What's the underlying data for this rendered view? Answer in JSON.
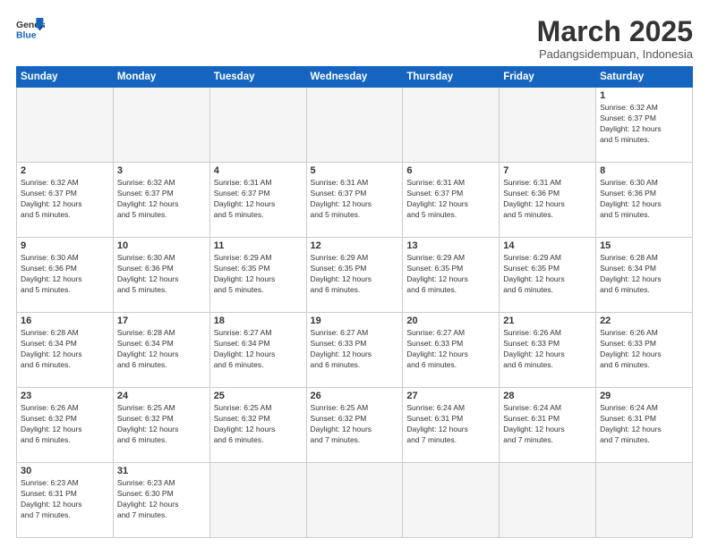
{
  "logo": {
    "text_general": "General",
    "text_blue": "Blue"
  },
  "header": {
    "month_title": "March 2025",
    "subtitle": "Padangsidempuan, Indonesia"
  },
  "days_of_week": [
    "Sunday",
    "Monday",
    "Tuesday",
    "Wednesday",
    "Thursday",
    "Friday",
    "Saturday"
  ],
  "weeks": [
    [
      {
        "day": "",
        "info": "",
        "empty": true
      },
      {
        "day": "",
        "info": "",
        "empty": true
      },
      {
        "day": "",
        "info": "",
        "empty": true
      },
      {
        "day": "",
        "info": "",
        "empty": true
      },
      {
        "day": "",
        "info": "",
        "empty": true
      },
      {
        "day": "",
        "info": "",
        "empty": true
      },
      {
        "day": "1",
        "info": "Sunrise: 6:32 AM\nSunset: 6:37 PM\nDaylight: 12 hours\nand 5 minutes.",
        "empty": false
      }
    ],
    [
      {
        "day": "2",
        "info": "Sunrise: 6:32 AM\nSunset: 6:37 PM\nDaylight: 12 hours\nand 5 minutes.",
        "empty": false
      },
      {
        "day": "3",
        "info": "Sunrise: 6:32 AM\nSunset: 6:37 PM\nDaylight: 12 hours\nand 5 minutes.",
        "empty": false
      },
      {
        "day": "4",
        "info": "Sunrise: 6:31 AM\nSunset: 6:37 PM\nDaylight: 12 hours\nand 5 minutes.",
        "empty": false
      },
      {
        "day": "5",
        "info": "Sunrise: 6:31 AM\nSunset: 6:37 PM\nDaylight: 12 hours\nand 5 minutes.",
        "empty": false
      },
      {
        "day": "6",
        "info": "Sunrise: 6:31 AM\nSunset: 6:37 PM\nDaylight: 12 hours\nand 5 minutes.",
        "empty": false
      },
      {
        "day": "7",
        "info": "Sunrise: 6:31 AM\nSunset: 6:36 PM\nDaylight: 12 hours\nand 5 minutes.",
        "empty": false
      },
      {
        "day": "8",
        "info": "Sunrise: 6:30 AM\nSunset: 6:36 PM\nDaylight: 12 hours\nand 5 minutes.",
        "empty": false
      }
    ],
    [
      {
        "day": "9",
        "info": "Sunrise: 6:30 AM\nSunset: 6:36 PM\nDaylight: 12 hours\nand 5 minutes.",
        "empty": false
      },
      {
        "day": "10",
        "info": "Sunrise: 6:30 AM\nSunset: 6:36 PM\nDaylight: 12 hours\nand 5 minutes.",
        "empty": false
      },
      {
        "day": "11",
        "info": "Sunrise: 6:29 AM\nSunset: 6:35 PM\nDaylight: 12 hours\nand 5 minutes.",
        "empty": false
      },
      {
        "day": "12",
        "info": "Sunrise: 6:29 AM\nSunset: 6:35 PM\nDaylight: 12 hours\nand 6 minutes.",
        "empty": false
      },
      {
        "day": "13",
        "info": "Sunrise: 6:29 AM\nSunset: 6:35 PM\nDaylight: 12 hours\nand 6 minutes.",
        "empty": false
      },
      {
        "day": "14",
        "info": "Sunrise: 6:29 AM\nSunset: 6:35 PM\nDaylight: 12 hours\nand 6 minutes.",
        "empty": false
      },
      {
        "day": "15",
        "info": "Sunrise: 6:28 AM\nSunset: 6:34 PM\nDaylight: 12 hours\nand 6 minutes.",
        "empty": false
      }
    ],
    [
      {
        "day": "16",
        "info": "Sunrise: 6:28 AM\nSunset: 6:34 PM\nDaylight: 12 hours\nand 6 minutes.",
        "empty": false
      },
      {
        "day": "17",
        "info": "Sunrise: 6:28 AM\nSunset: 6:34 PM\nDaylight: 12 hours\nand 6 minutes.",
        "empty": false
      },
      {
        "day": "18",
        "info": "Sunrise: 6:27 AM\nSunset: 6:34 PM\nDaylight: 12 hours\nand 6 minutes.",
        "empty": false
      },
      {
        "day": "19",
        "info": "Sunrise: 6:27 AM\nSunset: 6:33 PM\nDaylight: 12 hours\nand 6 minutes.",
        "empty": false
      },
      {
        "day": "20",
        "info": "Sunrise: 6:27 AM\nSunset: 6:33 PM\nDaylight: 12 hours\nand 6 minutes.",
        "empty": false
      },
      {
        "day": "21",
        "info": "Sunrise: 6:26 AM\nSunset: 6:33 PM\nDaylight: 12 hours\nand 6 minutes.",
        "empty": false
      },
      {
        "day": "22",
        "info": "Sunrise: 6:26 AM\nSunset: 6:33 PM\nDaylight: 12 hours\nand 6 minutes.",
        "empty": false
      }
    ],
    [
      {
        "day": "23",
        "info": "Sunrise: 6:26 AM\nSunset: 6:32 PM\nDaylight: 12 hours\nand 6 minutes.",
        "empty": false
      },
      {
        "day": "24",
        "info": "Sunrise: 6:25 AM\nSunset: 6:32 PM\nDaylight: 12 hours\nand 6 minutes.",
        "empty": false
      },
      {
        "day": "25",
        "info": "Sunrise: 6:25 AM\nSunset: 6:32 PM\nDaylight: 12 hours\nand 6 minutes.",
        "empty": false
      },
      {
        "day": "26",
        "info": "Sunrise: 6:25 AM\nSunset: 6:32 PM\nDaylight: 12 hours\nand 7 minutes.",
        "empty": false
      },
      {
        "day": "27",
        "info": "Sunrise: 6:24 AM\nSunset: 6:31 PM\nDaylight: 12 hours\nand 7 minutes.",
        "empty": false
      },
      {
        "day": "28",
        "info": "Sunrise: 6:24 AM\nSunset: 6:31 PM\nDaylight: 12 hours\nand 7 minutes.",
        "empty": false
      },
      {
        "day": "29",
        "info": "Sunrise: 6:24 AM\nSunset: 6:31 PM\nDaylight: 12 hours\nand 7 minutes.",
        "empty": false
      }
    ],
    [
      {
        "day": "30",
        "info": "Sunrise: 6:23 AM\nSunset: 6:31 PM\nDaylight: 12 hours\nand 7 minutes.",
        "empty": false
      },
      {
        "day": "31",
        "info": "Sunrise: 6:23 AM\nSunset: 6:30 PM\nDaylight: 12 hours\nand 7 minutes.",
        "empty": false
      },
      {
        "day": "",
        "info": "",
        "empty": true
      },
      {
        "day": "",
        "info": "",
        "empty": true
      },
      {
        "day": "",
        "info": "",
        "empty": true
      },
      {
        "day": "",
        "info": "",
        "empty": true
      },
      {
        "day": "",
        "info": "",
        "empty": true
      }
    ]
  ]
}
